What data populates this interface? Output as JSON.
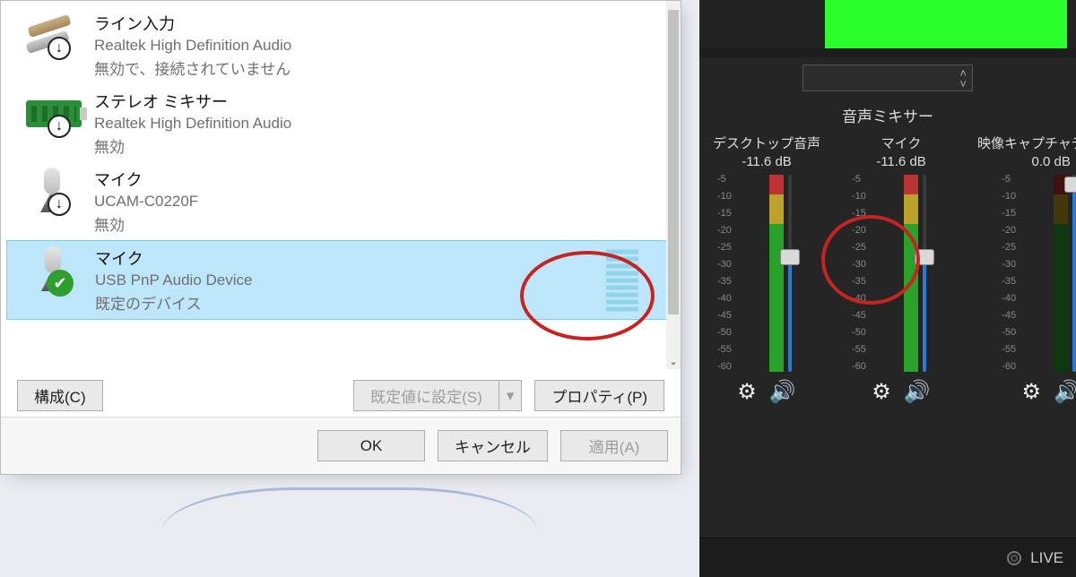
{
  "dialog": {
    "devices": [
      {
        "title": "ライン入力",
        "sub": "Realtek High Definition Audio",
        "status": "無効で、接続されていません",
        "icon": "jack",
        "badge": "arrow"
      },
      {
        "title": "ステレオ ミキサー",
        "sub": "Realtek High Definition Audio",
        "status": "無効",
        "icon": "card",
        "badge": "arrow"
      },
      {
        "title": "マイク",
        "sub": "UCAM-C0220F",
        "status": "無効",
        "icon": "mic",
        "badge": "arrow"
      },
      {
        "title": "マイク",
        "sub": "USB PnP Audio Device",
        "status": "既定のデバイス",
        "icon": "mic",
        "badge": "check",
        "selected": true,
        "level": 9
      }
    ],
    "buttons": {
      "configure": "構成(C)",
      "set_default": "既定値に設定(S)",
      "properties": "プロパティ(P)",
      "ok": "OK",
      "cancel": "キャンセル",
      "apply": "適用(A)"
    }
  },
  "obs": {
    "mixer_title": "音声ミキサー",
    "channels": [
      {
        "name": "デスクトップ音声",
        "db": "-11.6 dB",
        "fader_pct": 42,
        "darken_pct": 0
      },
      {
        "name": "マイク",
        "db": "-11.6 dB",
        "fader_pct": 42,
        "darken_pct": 0
      },
      {
        "name": "映像キャプチャデバイス",
        "db": "0.0 dB",
        "fader_pct": 5,
        "darken_pct": 100
      }
    ],
    "scale": [
      "5",
      "10",
      "15",
      "20",
      "25",
      "30",
      "35",
      "40",
      "45",
      "50",
      "55",
      "60"
    ],
    "live_label": "LIVE"
  }
}
